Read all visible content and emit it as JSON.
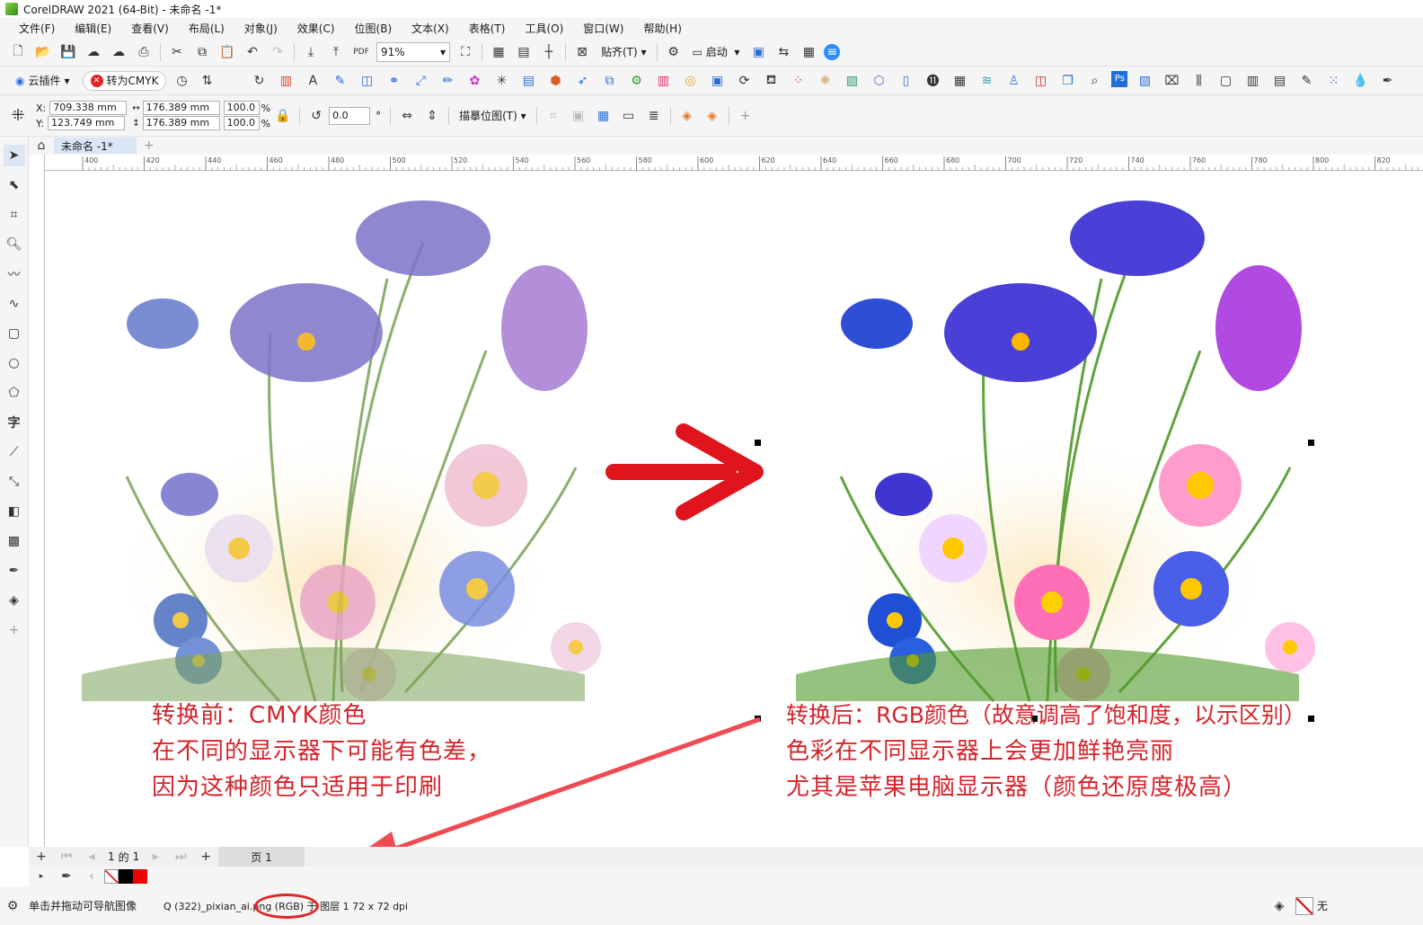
{
  "app": {
    "title": "CorelDRAW 2021 (64-Bit) - 未命名 -1*"
  },
  "menu": [
    "文件(F)",
    "编辑(E)",
    "查看(V)",
    "布局(L)",
    "对象(J)",
    "效果(C)",
    "位图(B)",
    "文本(X)",
    "表格(T)",
    "工具(O)",
    "窗口(W)",
    "帮助(H)"
  ],
  "toolbar": {
    "zoom": "91%",
    "snap": "贴齐(T)",
    "launch": "启动"
  },
  "plugins": {
    "cloud": "云插件",
    "cmyk": "转为CMYK"
  },
  "props": {
    "x": "709.338 mm",
    "y": "123.749 mm",
    "w": "176.389 mm",
    "h": "176.389 mm",
    "sx": "100.0",
    "sy": "100.0",
    "pct": "%",
    "angle": "0.0",
    "deg": "°",
    "trace": "描摹位图(T)",
    "xlab": "X:",
    "ylab": "Y:"
  },
  "doc": {
    "tab": "未命名 -1*"
  },
  "ruler": {
    "ticks": [
      "400",
      "420",
      "440",
      "460",
      "480",
      "500",
      "520",
      "540",
      "560",
      "580",
      "600",
      "620",
      "640",
      "660",
      "680",
      "700",
      "720",
      "740",
      "760",
      "780",
      "800",
      "820"
    ]
  },
  "captions": {
    "before": [
      "转换前：CMYK颜色",
      "在不同的显示器下可能有色差，",
      "因为这种颜色只适用于印刷"
    ],
    "after": [
      "转换后：RGB颜色（故意调高了饱和度，以示区别）",
      "色彩在不同显示器上会更加鲜艳亮丽",
      "尤其是苹果电脑显示器（颜色还原度极高）"
    ]
  },
  "pager": {
    "current": "1",
    "of": "的",
    "total": "1",
    "page_tab": "页 1"
  },
  "status": {
    "hint": "单击并拖动可导航图像",
    "object": "Q (322)_pixian_ai.png (RGB) 于 图层 1 72 x 72 dpi",
    "fill": "无"
  },
  "colors": {
    "accent": "#d6232b",
    "menuBg": "#f5f5f5"
  }
}
